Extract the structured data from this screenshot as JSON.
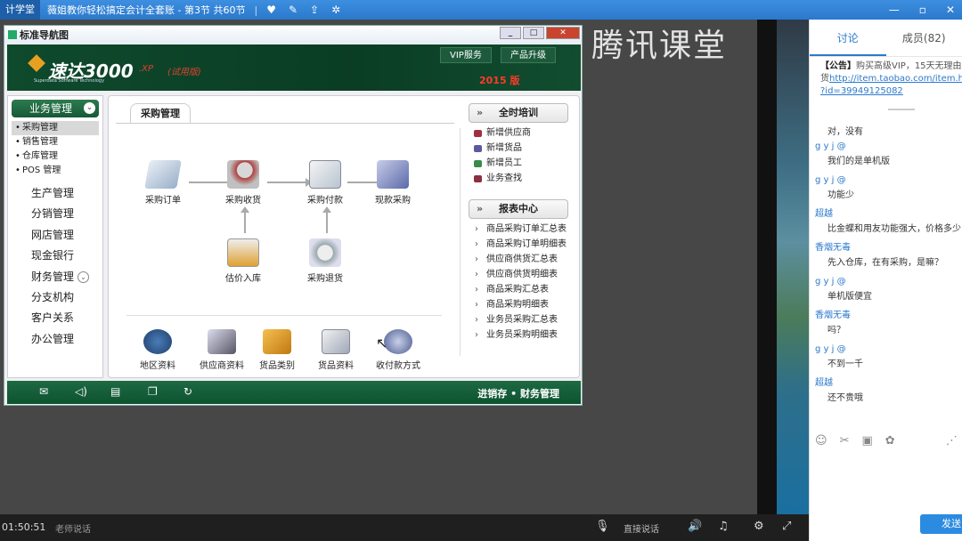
{
  "topbar": {
    "app_label": "计学堂",
    "course_title": "薇姐教你轻松搞定会计全套账 - 第3节 共60节",
    "icons": [
      "heart-icon",
      "edit-icon",
      "share-icon",
      "settings-icon"
    ],
    "window_icons": [
      "minimize-icon",
      "restore-icon",
      "close-icon"
    ]
  },
  "watermark": {
    "text": "腾讯课堂"
  },
  "app_window": {
    "title": "标准导航图",
    "brand": "速达3000",
    "brand_xp": ".XP",
    "brand_trial": "(试用版)",
    "brand_sub": "Superdata Software Technology",
    "year": "2015 版",
    "top_buttons": [
      "VIP服务",
      "产品升级"
    ]
  },
  "left_nav": {
    "head": "业务管理",
    "sub_items": [
      "采购管理",
      "销售管理",
      "仓库管理",
      "POS 管理"
    ],
    "main_items": [
      "生产管理",
      "分销管理",
      "网店管理",
      "现金银行",
      "财务管理",
      "分支机构",
      "客户关系",
      "办公管理"
    ]
  },
  "center": {
    "tab": "采购管理",
    "flow": {
      "order": "采购订单",
      "receive": "采购收货",
      "pay": "采购付款",
      "cash": "现款采购",
      "estimate": "估价入库",
      "return": "采购退货"
    },
    "bottom": [
      "地区资料",
      "供应商资料",
      "货品类别",
      "货品资料",
      "收付款方式"
    ]
  },
  "side": {
    "training_head": "全时培训",
    "training_links": [
      "新增供应商",
      "新增货品",
      "新增员工",
      "业务查找"
    ],
    "report_head": "报表中心",
    "report_links": [
      "商品采购订单汇总表",
      "商品采购订单明细表",
      "供应商供货汇总表",
      "供应商供货明细表",
      "商品采购汇总表",
      "商品采购明细表",
      "业务员采购汇总表",
      "业务员采购明细表"
    ]
  },
  "statusbar": {
    "right_text": "进销存 • 财务管理"
  },
  "controls": {
    "time": "01:50:51",
    "teacher": "老师说话",
    "live": "直接说话"
  },
  "chat": {
    "tab_discuss": "讨论",
    "tab_members": "成员(82)",
    "notice_label": "【公告】",
    "notice_line1": "购买高级VIP，15天无理由退",
    "notice_line2_prefix": "货",
    "notice_link1": "http://item.taobao.com/item.ht",
    "notice_link2": "?id=39949125082",
    "first_text": "对，没有",
    "messages": [
      {
        "name": "g y j @",
        "text": "我们的是单机版"
      },
      {
        "name": "g y j @",
        "text": "功能少"
      },
      {
        "name": "超越",
        "text": "比金蝶和用友功能强大，价格多少"
      },
      {
        "name": "香烟无毒",
        "text": "先入仓库，在有采购，是嘛？"
      },
      {
        "name": "g y j @",
        "text": "单机版便宜"
      },
      {
        "name": "香烟无毒",
        "text": "吗？"
      },
      {
        "name": "g y j @",
        "text": "不到一千"
      },
      {
        "name": "超越",
        "text": "还不贵哦"
      }
    ],
    "send_label": "发送"
  }
}
